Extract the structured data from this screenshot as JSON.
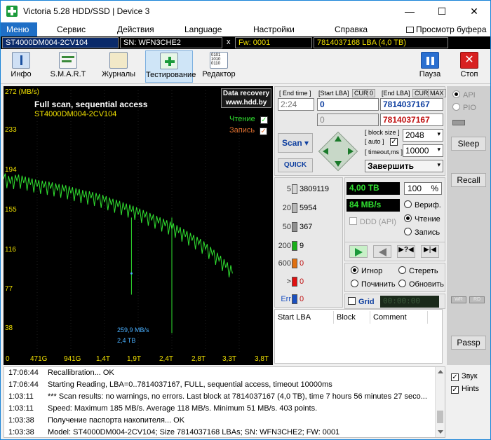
{
  "window": {
    "title": "Victoria 5.28 HDD/SSD | Device 3",
    "controls": [
      "—",
      "☐",
      "✕"
    ]
  },
  "menu": {
    "items": [
      "Меню",
      "Сервис",
      "Действия",
      "Language",
      "Настройки",
      "Справка"
    ],
    "passport_viewer": "Просмотр буфера"
  },
  "drive_info": {
    "model": "ST4000DM004-2CV104",
    "serial": "SN: WFN3CHE2",
    "close": "x",
    "firmware": "Fw: 0001",
    "capacity": "7814037168 LBA (4,0 TB)"
  },
  "toolbar": {
    "info": "Инфо",
    "smart": "S.M.A.R.T",
    "logs": "Журналы",
    "testing": "Тестирование",
    "editor": "Редактор",
    "pause": "Пауза",
    "stop": "Стоп"
  },
  "graph": {
    "y_unit": "272 (MB/s)",
    "y_ticks": [
      "233",
      "194",
      "155",
      "116",
      "77",
      "38"
    ],
    "x_ticks": [
      "0",
      "471G",
      "941G",
      "1,4T",
      "1,9T",
      "2,4T",
      "2,8T",
      "3,3T",
      "3,8T"
    ],
    "title": "Full scan, sequential access",
    "model": "ST4000DM004-2CV104",
    "watermark_line1": "Data recovery",
    "watermark_line2": "www.hdd.by",
    "read_label": "Чтение",
    "write_label": "Запись",
    "speed_readout": "259,9 MB/s",
    "position_readout": "2,4 TB",
    "y_max": 272,
    "x_max_tb": 3.8
  },
  "chart_data": {
    "type": "line",
    "title": "Full scan, sequential access",
    "ylabel": "MB/s",
    "ylim": [
      0,
      272
    ],
    "xlim_tb": [
      0,
      4.0
    ],
    "series": [
      {
        "name": "Чтение",
        "x_tb": [
          0.0,
          0.1,
          0.2,
          0.3,
          0.4,
          0.5,
          0.6,
          0.7,
          0.8,
          0.9,
          1.0,
          1.1,
          1.2,
          1.3,
          1.4,
          1.5,
          1.6,
          1.7,
          1.8,
          1.9,
          2.0,
          2.1,
          2.2,
          2.3,
          2.4,
          2.5,
          2.6,
          2.7,
          2.8,
          2.9,
          3.0,
          3.1,
          3.2,
          3.3,
          3.4
        ],
        "values": [
          180,
          175,
          178,
          176,
          174,
          172,
          171,
          170,
          168,
          167,
          165,
          163,
          161,
          160,
          158,
          156,
          153,
          151,
          148,
          146,
          143,
          140,
          137,
          134,
          131,
          128,
          124,
          120,
          116,
          112,
          107,
          101,
          95,
          88,
          82
        ]
      }
    ]
  },
  "scan_params": {
    "end_time_label": "[ End time ]",
    "end_time": "2:24",
    "start_lba_label": "[Start LBA]",
    "cur1": "CUR",
    "zero1": "0",
    "start_lba": "0",
    "current_lba": "0",
    "end_lba_label": "[End LBA]",
    "cur2": "CUR",
    "max": "MAX",
    "end_lba": "7814037167",
    "end_lba_red": "7814037167",
    "scan_btn": "Scan",
    "quick_btn": "QUICK",
    "block_size_label": "[ block size ]",
    "auto_label": "[ auto ]",
    "block_size": "2048",
    "timeout_label": "[ timeout,ms ]",
    "timeout": "10000",
    "finish_action": "Завершить"
  },
  "counters": [
    {
      "ms": "5",
      "count": "3809119",
      "color": "#d8d8d8"
    },
    {
      "ms": "20",
      "count": "5954",
      "color": "#b8b8b8"
    },
    {
      "ms": "50",
      "count": "367",
      "color": "#909090"
    },
    {
      "ms": "200",
      "count": "9",
      "color": "#18b018"
    },
    {
      "ms": "600",
      "count": "0",
      "color": "#e07010"
    },
    {
      "ms": ">",
      "count": "0",
      "color": "#e01010"
    },
    {
      "ms": "Err",
      "count": "0",
      "color": "#1a50c0"
    }
  ],
  "status": {
    "size_done": "4,00 TB",
    "percent": "100",
    "percent_unit": "%",
    "speed": "84 MB/s",
    "verify": "Вериф.",
    "read": "Чтение",
    "write": "Запись",
    "ddd": "DDD (API)"
  },
  "actions": {
    "ignore": "Игнор",
    "erase": "Стереть",
    "repair": "Починить",
    "refresh": "Обновить",
    "grid": "Grid",
    "grid_time": "00:00:00"
  },
  "table": {
    "headers": [
      "Start LBA",
      "Block",
      "Comment"
    ]
  },
  "right_panel": {
    "api": "API",
    "pio": "PIO",
    "sleep": "Sleep",
    "recall": "Recall",
    "wr": "WR",
    "rd": "RD",
    "passp": "Passp"
  },
  "log": [
    {
      "time": "17:06:44",
      "msg": "Recallibration... OK"
    },
    {
      "time": "17:06:44",
      "msg": "Starting Reading, LBA=0..7814037167, FULL, sequential access, timeout 10000ms"
    },
    {
      "time": "1:03:11",
      "msg": "*** Scan results: no warnings, no errors. Last block at 7814037167 (4,0 TB), time 7 hours 56 minutes 27 seco..."
    },
    {
      "time": "1:03:11",
      "msg": "Speed: Maximum 185 MB/s. Average 118 MB/s. Minimum 51 MB/s. 403 points."
    },
    {
      "time": "1:03:38",
      "msg": "Получение паспорта накопителя... OK"
    },
    {
      "time": "1:03:38",
      "msg": "Model: ST4000DM004-2CV104; Size 7814037168 LBAs; SN: WFN3CHE2; FW: 0001"
    }
  ],
  "bottom_opts": {
    "sound": "Звук",
    "hints": "Hints"
  }
}
